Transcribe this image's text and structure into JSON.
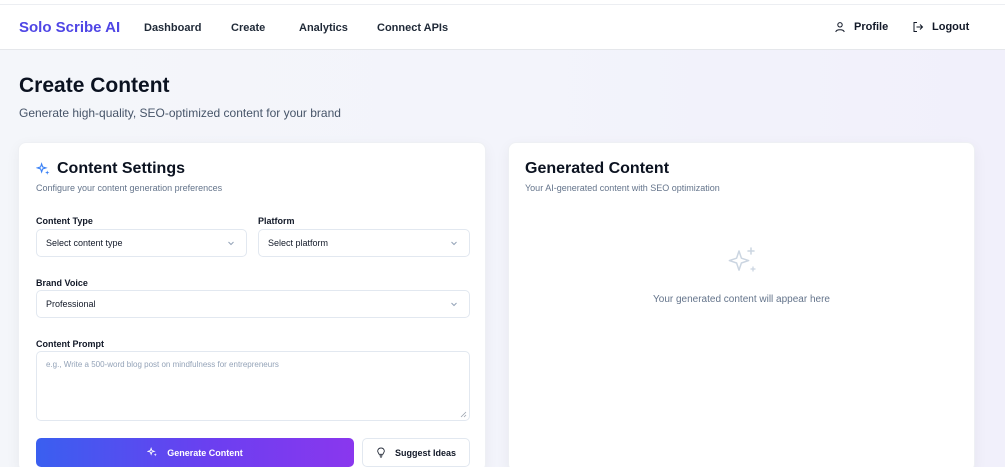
{
  "app": {
    "brand": "Solo Scribe AI",
    "nav": [
      "Dashboard",
      "Create",
      "Analytics",
      "Connect APIs"
    ],
    "profile_label": "Profile",
    "logout_label": "Logout",
    "brand_color": "#4f46e5"
  },
  "page": {
    "title": "Create Content",
    "subtitle": "Generate high-quality, SEO-optimized content for your brand"
  },
  "settings": {
    "title": "Content Settings",
    "subtitle": "Configure your content generation preferences",
    "content_type": {
      "label": "Content Type",
      "value": "Select content type"
    },
    "platform": {
      "label": "Platform",
      "value": "Select platform"
    },
    "brand_voice": {
      "label": "Brand Voice",
      "value": "Professional"
    },
    "prompt": {
      "label": "Content Prompt",
      "placeholder": "e.g., Write a 500-word blog post on mindfulness for entrepreneurs"
    },
    "generate_label": "Generate Content",
    "suggest_label": "Suggest Ideas",
    "icons": {
      "title": "sparkles-icon",
      "generate": "sparkles-icon",
      "suggest": "lightbulb-icon"
    }
  },
  "output": {
    "title": "Generated Content",
    "subtitle": "Your AI-generated content with SEO optimization",
    "empty_message": "Your generated content will appear here",
    "icon": "sparkles-icon"
  }
}
